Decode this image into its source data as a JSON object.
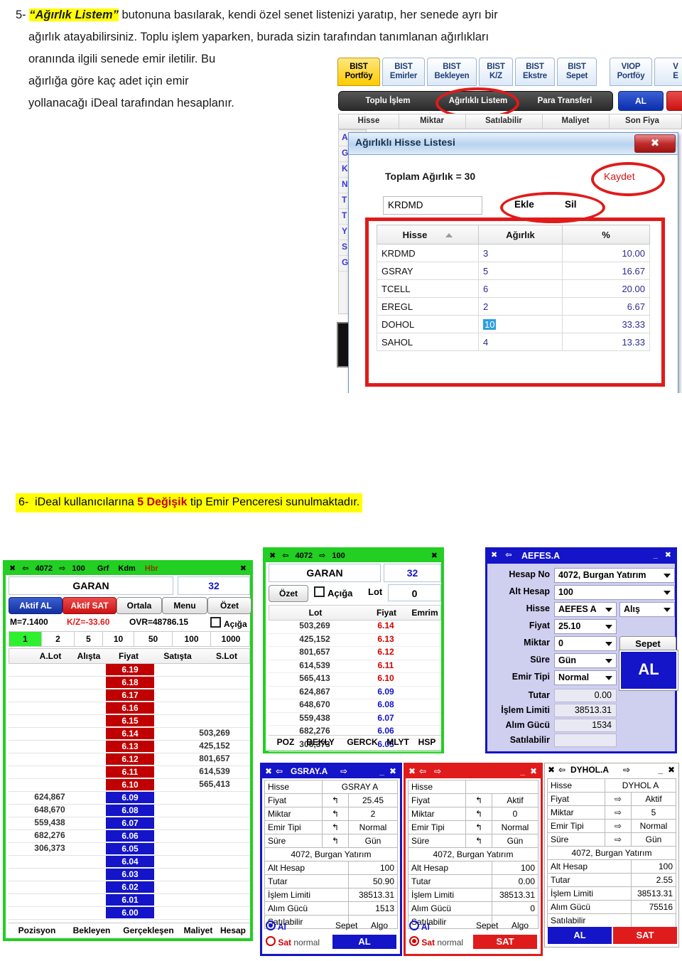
{
  "section5": {
    "number": "5-",
    "highlight": "“Ağırlık Listem”",
    "rest1": " butonuna basılarak, kendi özel senet listenizi yaratıp, her senede ayrı bir",
    "line2": "ağırlık atayabilirsiniz. Toplu işlem yaparken, burada sizin tarafından tanımlanan ağırlıkları",
    "line3": "oranında ilgili senede emir iletilir. Bu",
    "line4": "ağırlığa göre kaç adet için emir",
    "line5": "yollanacağı iDeal tarafından hesaplanır."
  },
  "section6": {
    "number": "6-",
    "pre": "iDeal kullanıcılarına ",
    "red": "5 Değişik",
    "post": " tip Emir Penceresi sunulmaktadır."
  },
  "tabs": [
    {
      "l1": "BIST",
      "l2": "Portföy",
      "selected": true
    },
    {
      "l1": "BIST",
      "l2": "Emirler",
      "selected": false
    },
    {
      "l1": "BIST",
      "l2": "Bekleyen",
      "selected": false
    },
    {
      "l1": "BIST",
      "l2": "K/Z",
      "selected": false
    },
    {
      "l1": "BIST",
      "l2": "Ekstre",
      "selected": false
    },
    {
      "l1": "BIST",
      "l2": "Sepet",
      "selected": false
    },
    {
      "l1": "VIOP",
      "l2": "Portföy",
      "selected": false
    },
    {
      "l1": "V",
      "l2": "E",
      "selected": false
    }
  ],
  "toolbar": {
    "toplu_islem": "Toplu İşlem",
    "agirlikli_listem": "Ağırlıklı Listem",
    "para_transferi": "Para Transferi",
    "al": "AL"
  },
  "bg_grid": {
    "headers": [
      "Hisse",
      "Miktar",
      "Satılabilir",
      "Maliyet",
      "Son Fiya"
    ],
    "rows": [
      "A",
      "G",
      "K",
      "N",
      "T",
      "T",
      "Y",
      "S",
      "G"
    ]
  },
  "dialog": {
    "title": "Ağırlıklı Hisse Listesi",
    "close": "✖",
    "total": "Toplam Ağırlık = 30",
    "save": "Kaydet",
    "symbol_value": "KRDMD",
    "add": "Ekle",
    "delete": "Sil",
    "columns": [
      "Hisse",
      "Ağırlık",
      "%"
    ],
    "rows": [
      {
        "hisse": "KRDMD",
        "agirlik": "3",
        "pct": "10.00",
        "selected": false
      },
      {
        "hisse": "GSRAY",
        "agirlik": "5",
        "pct": "16.67",
        "selected": false
      },
      {
        "hisse": "TCELL",
        "agirlik": "6",
        "pct": "20.00",
        "selected": false
      },
      {
        "hisse": "EREGL",
        "agirlik": "2",
        "pct": "6.67",
        "selected": false
      },
      {
        "hisse": "DOHOL",
        "agirlik": "10",
        "pct": "33.33",
        "selected": true
      },
      {
        "hisse": "SAHOL",
        "agirlik": "4",
        "pct": "13.33",
        "selected": false
      }
    ]
  },
  "garan_big": {
    "titlebar": {
      "close": "✖",
      "left_arrow": "⇦",
      "account": "4072",
      "right_arrow": "⇨",
      "subaccount": "100",
      "grf": "Grf",
      "kdm": "Kdm",
      "hbr": "Hbr",
      "x": "✖"
    },
    "symbol": "GARAN",
    "qty_box": "32",
    "buttons": [
      "Aktif AL",
      "Aktif SAT",
      "Ortala",
      "Menu",
      "Özet"
    ],
    "stat_m": "M=7.1400",
    "stat_kz": "K/Z=-33.60",
    "stat_ovr": "OVR=48786.15",
    "acigastr": "Açığa",
    "steps": [
      "1",
      "2",
      "5",
      "10",
      "50",
      "100",
      "1000"
    ],
    "selected_step": "1",
    "columns": [
      "A.Lot",
      "Alışta",
      "Fiyat",
      "Satışta",
      "S.Lot"
    ],
    "depth": [
      {
        "alot": "",
        "price": "6.19",
        "side": "sell",
        "slot": ""
      },
      {
        "alot": "",
        "price": "6.18",
        "side": "sell",
        "slot": ""
      },
      {
        "alot": "",
        "price": "6.17",
        "side": "sell",
        "slot": ""
      },
      {
        "alot": "",
        "price": "6.16",
        "side": "sell",
        "slot": ""
      },
      {
        "alot": "",
        "price": "6.15",
        "side": "sell",
        "slot": ""
      },
      {
        "alot": "",
        "price": "6.14",
        "side": "sell",
        "slot": "503,269"
      },
      {
        "alot": "",
        "price": "6.13",
        "side": "sell",
        "slot": "425,152"
      },
      {
        "alot": "",
        "price": "6.12",
        "side": "sell",
        "slot": "801,657"
      },
      {
        "alot": "",
        "price": "6.11",
        "side": "sell",
        "slot": "614,539"
      },
      {
        "alot": "",
        "price": "6.10",
        "side": "sell",
        "slot": "565,413"
      },
      {
        "alot": "624,867",
        "price": "6.09",
        "side": "buy",
        "slot": ""
      },
      {
        "alot": "648,670",
        "price": "6.08",
        "side": "buy",
        "slot": ""
      },
      {
        "alot": "559,438",
        "price": "6.07",
        "side": "buy",
        "slot": ""
      },
      {
        "alot": "682,276",
        "price": "6.06",
        "side": "buy",
        "slot": ""
      },
      {
        "alot": "306,373",
        "price": "6.05",
        "side": "buy",
        "slot": ""
      },
      {
        "alot": "",
        "price": "6.04",
        "side": "buy",
        "slot": ""
      },
      {
        "alot": "",
        "price": "6.03",
        "side": "buy",
        "slot": ""
      },
      {
        "alot": "",
        "price": "6.02",
        "side": "buy",
        "slot": ""
      },
      {
        "alot": "",
        "price": "6.01",
        "side": "buy",
        "slot": ""
      },
      {
        "alot": "",
        "price": "6.00",
        "side": "buy",
        "slot": ""
      }
    ],
    "footer": [
      "Pozisyon",
      "Bekleyen",
      "Gerçekleşen",
      "Maliyet",
      "Hesap"
    ]
  },
  "garan_small": {
    "titlebar": {
      "close": "✖",
      "left_arrow": "⇦",
      "account": "4072",
      "right_arrow": "⇨",
      "subaccount": "100",
      "x": "✖"
    },
    "symbol": "GARAN",
    "qty_box": "32",
    "ozet": "Özet",
    "aciga": "Açığa",
    "lot_label": "Lot",
    "lot_value": "0",
    "columns": [
      "Lot",
      "Fiyat",
      "Emrim"
    ],
    "rows": [
      {
        "lot": "503,269",
        "price": "6.14",
        "side": "sell"
      },
      {
        "lot": "425,152",
        "price": "6.13",
        "side": "sell"
      },
      {
        "lot": "801,657",
        "price": "6.12",
        "side": "sell"
      },
      {
        "lot": "614,539",
        "price": "6.11",
        "side": "sell"
      },
      {
        "lot": "565,413",
        "price": "6.10",
        "side": "sell"
      },
      {
        "lot": "624,867",
        "price": "6.09",
        "side": "buy"
      },
      {
        "lot": "648,670",
        "price": "6.08",
        "side": "buy"
      },
      {
        "lot": "559,438",
        "price": "6.07",
        "side": "buy"
      },
      {
        "lot": "682,276",
        "price": "6.06",
        "side": "buy"
      },
      {
        "lot": "306,373",
        "price": "6.05",
        "side": "buy"
      }
    ],
    "footer": [
      "POZ",
      "BEKLY",
      "GERCK",
      "MLYT",
      "HSP"
    ]
  },
  "aefes": {
    "titlebar": {
      "close": "✖",
      "back": "⇦",
      "title": "AEFES.A",
      "minimize": "_",
      "x": "✖"
    },
    "fields": [
      {
        "label": "Hesap No",
        "value": "4072, Burgan Yatırım"
      },
      {
        "label": "Alt Hesap",
        "value": "100"
      },
      {
        "label": "Hisse",
        "value": "AEFES A"
      },
      {
        "label": "Fiyat",
        "value": "25.10"
      },
      {
        "label": "Miktar",
        "value": "0"
      },
      {
        "label": "Süre",
        "value": "Gün"
      },
      {
        "label": "Emir Tipi",
        "value": "Normal"
      }
    ],
    "side": "Alış",
    "sepet": "Sepet",
    "al": "AL",
    "readonly": [
      {
        "label": "Tutar",
        "value": "0.00"
      },
      {
        "label": "İşlem Limiti",
        "value": "38513.31"
      },
      {
        "label": "Alım Gücü",
        "value": "1534"
      },
      {
        "label": "Satılabilir",
        "value": ""
      }
    ]
  },
  "gsray": {
    "titlebar": {
      "close": "✖",
      "back": "⇦",
      "title": "GSRAY.A",
      "fwd": "⇨",
      "minimize": "_",
      "x": "✖"
    },
    "rows": [
      {
        "label": "Hisse",
        "icon": "",
        "value": "GSRAY A"
      },
      {
        "label": "Fiyat",
        "icon": "↰",
        "value": "25.45"
      },
      {
        "label": "Miktar",
        "icon": "↰",
        "value": "2"
      },
      {
        "label": "Emir Tipi",
        "icon": "↰",
        "value": "Normal"
      },
      {
        "label": "Süre",
        "icon": "↰",
        "value": "Gün"
      }
    ],
    "account": "4072, Burgan Yatırım",
    "rows2": [
      {
        "label": "Alt Hesap",
        "value": "100"
      },
      {
        "label": "Tutar",
        "value": "50.90"
      },
      {
        "label": "İşlem Limiti",
        "value": "38513.31"
      },
      {
        "label": "Alım Gücü",
        "value": "1513"
      },
      {
        "label": "Satılabilir",
        "value": ""
      }
    ],
    "al_radio": "Al",
    "sat_radio": "Sat",
    "normal": "normal",
    "sepet": "Sepet",
    "algo": "Algo",
    "button": "AL",
    "selected": "al"
  },
  "sat_window": {
    "titlebar": {
      "close": "✖",
      "back": "⇦",
      "title": "",
      "fwd": "⇨",
      "minimize": "_",
      "x": "✖"
    },
    "rows": [
      {
        "label": "Hisse",
        "icon": "",
        "value": ""
      },
      {
        "label": "Fiyat",
        "icon": "↰",
        "value": "Aktif"
      },
      {
        "label": "Miktar",
        "icon": "↰",
        "value": "0"
      },
      {
        "label": "Emir Tipi",
        "icon": "↰",
        "value": "Normal"
      },
      {
        "label": "Süre",
        "icon": "↰",
        "value": "Gün"
      }
    ],
    "account": "4072, Burgan Yatırım",
    "rows2": [
      {
        "label": "Alt Hesap",
        "value": "100"
      },
      {
        "label": "Tutar",
        "value": "0.00"
      },
      {
        "label": "İşlem Limiti",
        "value": "38513.31"
      },
      {
        "label": "Alım Gücü",
        "value": "0"
      },
      {
        "label": "Satılabilir",
        "value": ""
      }
    ],
    "al_radio": "Al",
    "sat_radio": "Sat",
    "normal": "normal",
    "sepet": "Sepet",
    "algo": "Algo",
    "button": "SAT",
    "selected": "sat"
  },
  "dyhol": {
    "titlebar": {
      "close": "✖",
      "back": "⇦",
      "title": "DYHOL.A",
      "fwd": "⇨",
      "minimize": "_",
      "x": "✖"
    },
    "rows": [
      {
        "label": "Hisse",
        "icon": "",
        "value": "DYHOL A"
      },
      {
        "label": "Fiyat",
        "icon": "⇨",
        "value": "Aktif"
      },
      {
        "label": "Miktar",
        "icon": "⇨",
        "value": "5"
      },
      {
        "label": "Emir Tipi",
        "icon": "⇨",
        "value": "Normal"
      },
      {
        "label": "Süre",
        "icon": "⇨",
        "value": "Gün"
      }
    ],
    "account": "4072, Burgan Yatırım",
    "rows2": [
      {
        "label": "Alt Hesap",
        "value": "100"
      },
      {
        "label": "Tutar",
        "value": "2.55"
      },
      {
        "label": "İşlem Limiti",
        "value": "38513.31"
      },
      {
        "label": "Alım Gücü",
        "value": "75516"
      },
      {
        "label": "Satılabilir",
        "value": ""
      }
    ],
    "al_button": "AL",
    "sat_button": "SAT"
  },
  "colors": {
    "green_frame": "#22cf22",
    "blue": "#1414c8",
    "red": "#e01b1b",
    "sell_red": "#c00000",
    "highlight_yellow": "#ffff00",
    "tab_selected": "#ffcc00"
  }
}
